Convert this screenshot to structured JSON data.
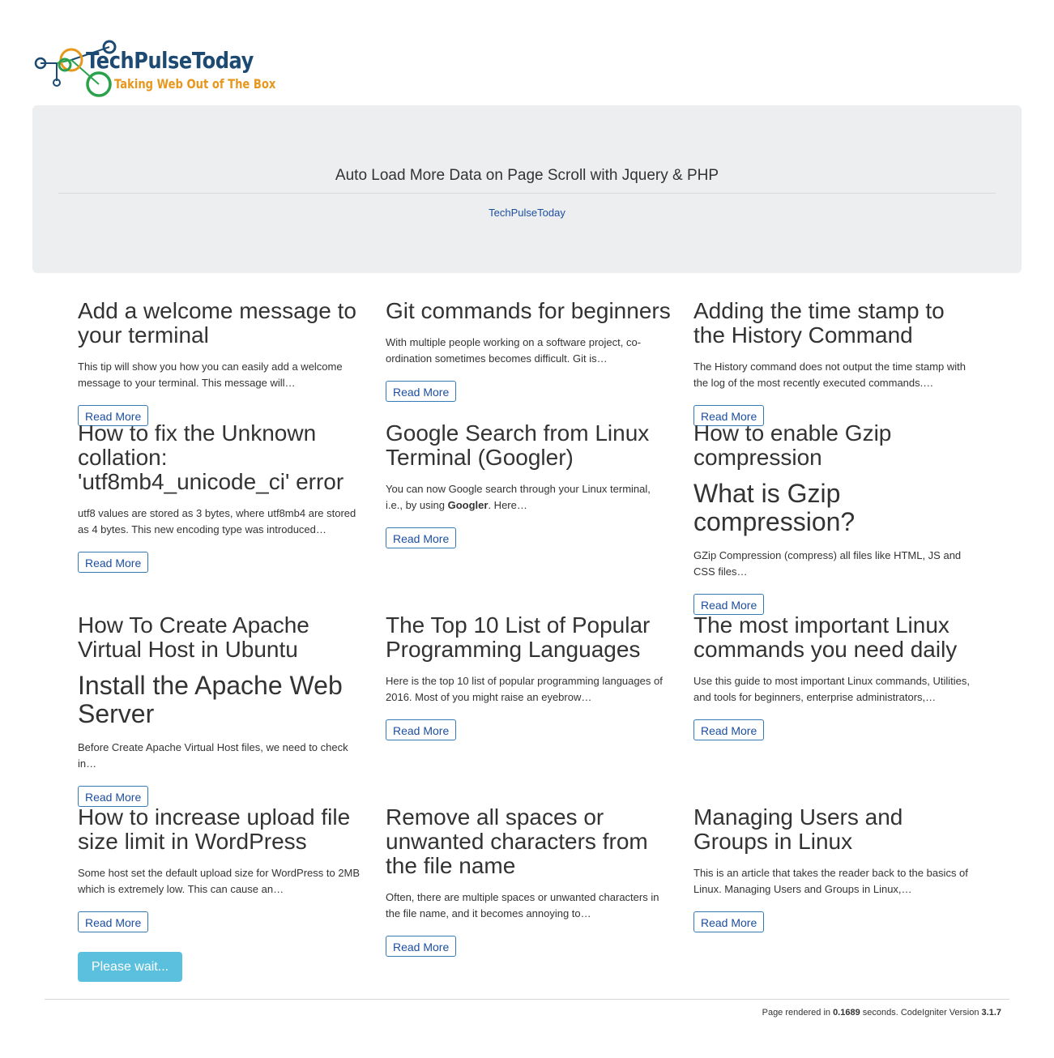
{
  "logo": {
    "title": "TechPulseToday",
    "tagline": "Taking Web Out of The Box"
  },
  "header": {
    "title": "Auto Load More Data on Page Scroll with Jquery & PHP",
    "link": "TechPulseToday"
  },
  "read_more_label": "Read More",
  "posts": [
    {
      "title": "Add a welcome message to your terminal",
      "excerpt": "This tip will show you how you can easily add a welcome message to your terminal. This message will…"
    },
    {
      "title": "Git commands for beginners",
      "excerpt": "With multiple people working on a software project, co-ordination sometimes becomes difficult. Git is…"
    },
    {
      "title": "Adding the time stamp to the History Command",
      "excerpt": "The History command does not output the time stamp with the log of the most recently executed commands.…"
    },
    {
      "title": "How to fix the Unknown collation: 'utf8mb4_unicode_ci' error",
      "excerpt": "utf8 values are stored as 3 bytes, where utf8mb4 are stored as 4 bytes. This new encoding type was introduced…"
    },
    {
      "title": "Google Search from Linux Terminal (Googler)",
      "excerpt_pre": "You can now Google search through your Linux terminal, i.e., by using ",
      "excerpt_bold": "Googler",
      "excerpt_post": ". Here…"
    },
    {
      "title": "How to enable Gzip compression",
      "subheading": "What is Gzip compression?",
      "excerpt": "GZip Compression (compress) all files like HTML, JS and CSS files…"
    },
    {
      "title": "How To Create Apache Virtual Host in Ubuntu",
      "subheading": "Install the Apache Web Server",
      "excerpt": "Before Create Apache Virtual Host files, we need to check in…"
    },
    {
      "title": "The Top 10 List of Popular Programming Languages",
      "excerpt": "Here is the top 10 list of popular programming languages of 2016. Most of you might raise an eyebrow…"
    },
    {
      "title": "The most important Linux commands you need daily",
      "excerpt": "Use this guide to most important Linux commands, Utilities, and tools for beginners, enterprise administrators,…"
    },
    {
      "title": "How to increase upload file size limit in WordPress",
      "excerpt": "Some host set the default upload size for WordPress to 2MB which is extremely low. This can cause an…"
    },
    {
      "title": "Remove all spaces or unwanted characters from the file name",
      "excerpt": "Often, there are multiple spaces or unwanted characters in the file name, and it becomes annoying to…"
    },
    {
      "title": "Managing Users and Groups in Linux",
      "excerpt": "This is an article that takes the reader back to the basics of Linux. Managing Users and Groups in Linux,…"
    }
  ],
  "load_button": "Please wait...",
  "footer": {
    "prefix": "Page rendered in ",
    "time": "0.1689",
    "middle": " seconds. CodeIgniter Version ",
    "version": "3.1.7"
  }
}
